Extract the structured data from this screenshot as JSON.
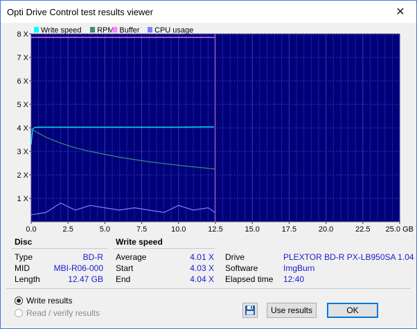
{
  "window": {
    "title": "Opti Drive Control test results viewer",
    "close_glyph": "✕"
  },
  "chart_data": {
    "type": "line",
    "title": "",
    "x_tick_labels": [
      "0.0",
      "2.5",
      "5.0",
      "7.5",
      "10.0",
      "12.5",
      "15.0",
      "17.5",
      "20.0",
      "22.5",
      "25.0 GB"
    ],
    "y_tick_labels": [
      "1 X",
      "2 X",
      "3 X",
      "4 X",
      "5 X",
      "6 X",
      "7 X",
      "8 X"
    ],
    "xlim": [
      0,
      25
    ],
    "ylim": [
      0,
      8
    ],
    "xunit": "GB",
    "legend": [
      {
        "name": "Write speed",
        "color": "#00ffff"
      },
      {
        "name": "RPM",
        "color": "#3c8c78"
      },
      {
        "name": "Buffer",
        "color": "#ff80ff"
      },
      {
        "name": "CPU usage",
        "color": "#8080ff"
      }
    ],
    "legend_position": "top-left",
    "grid": true,
    "background_color": "#00007a",
    "end_x": 12.47,
    "series": [
      {
        "name": "Write speed",
        "x": [
          0,
          0.1,
          0.25,
          0.5,
          1,
          2,
          4,
          6,
          8,
          10,
          12,
          12.4
        ],
        "values": [
          3.3,
          3.95,
          4.02,
          4.03,
          4.03,
          4.03,
          4.03,
          4.03,
          4.03,
          4.03,
          4.04,
          4.04
        ]
      },
      {
        "name": "RPM",
        "x": [
          0,
          1,
          2,
          3,
          4,
          5,
          6,
          7,
          8,
          9,
          10,
          11,
          12,
          12.47
        ],
        "values": [
          3.95,
          3.6,
          3.35,
          3.15,
          3.0,
          2.87,
          2.75,
          2.65,
          2.56,
          2.48,
          2.41,
          2.34,
          2.28,
          2.25
        ]
      },
      {
        "name": "Buffer",
        "x": [
          0,
          12.47
        ],
        "values": [
          7.85,
          7.85
        ]
      },
      {
        "name": "CPU usage",
        "x": [
          0,
          1,
          2,
          3,
          4,
          5,
          6,
          7,
          8,
          9,
          10,
          11,
          12,
          12.47
        ],
        "values": [
          0.3,
          0.4,
          0.8,
          0.5,
          0.7,
          0.6,
          0.5,
          0.6,
          0.5,
          0.4,
          0.7,
          0.5,
          0.6,
          0.4
        ]
      }
    ]
  },
  "disc": {
    "header": "Disc",
    "type_label": "Type",
    "type_value": "BD-R",
    "mid_label": "MID",
    "mid_value": "MBI-R06-000",
    "length_label": "Length",
    "length_value": "12.47 GB"
  },
  "write_speed": {
    "header": "Write speed",
    "average_label": "Average",
    "average_value": "4.01 X",
    "start_label": "Start",
    "start_value": "4.03 X",
    "end_label": "End",
    "end_value": "4.04 X"
  },
  "drive_info": {
    "drive_label": "Drive",
    "drive_value": "PLEXTOR  BD-R  PX-LB950SA 1.04",
    "software_label": "Software",
    "software_value": "ImgBurn",
    "elapsed_label": "Elapsed time",
    "elapsed_value": "12:40"
  },
  "options": {
    "write_results": "Write results",
    "read_verify_results": "Read / verify results",
    "selected": "write_results"
  },
  "buttons": {
    "save_icon": "floppy-disk",
    "use_results": "Use results",
    "ok": "OK"
  }
}
